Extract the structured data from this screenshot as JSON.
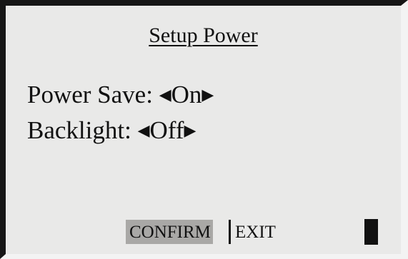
{
  "screen": {
    "title": "Setup Power",
    "settings": [
      {
        "label": "Power Save:",
        "value": "On"
      },
      {
        "label": "Backlight:",
        "value": "Off"
      }
    ],
    "arrows": {
      "left": "◀",
      "right": "▶"
    }
  },
  "softkeys": {
    "confirm": "CONFIRM",
    "exit": "EXIT",
    "selected": "CONFIRM"
  },
  "icons": {
    "battery": "battery-icon"
  },
  "colors": {
    "background": "#e9e9e8",
    "highlight": "#a9a8a6",
    "text": "#111111"
  }
}
